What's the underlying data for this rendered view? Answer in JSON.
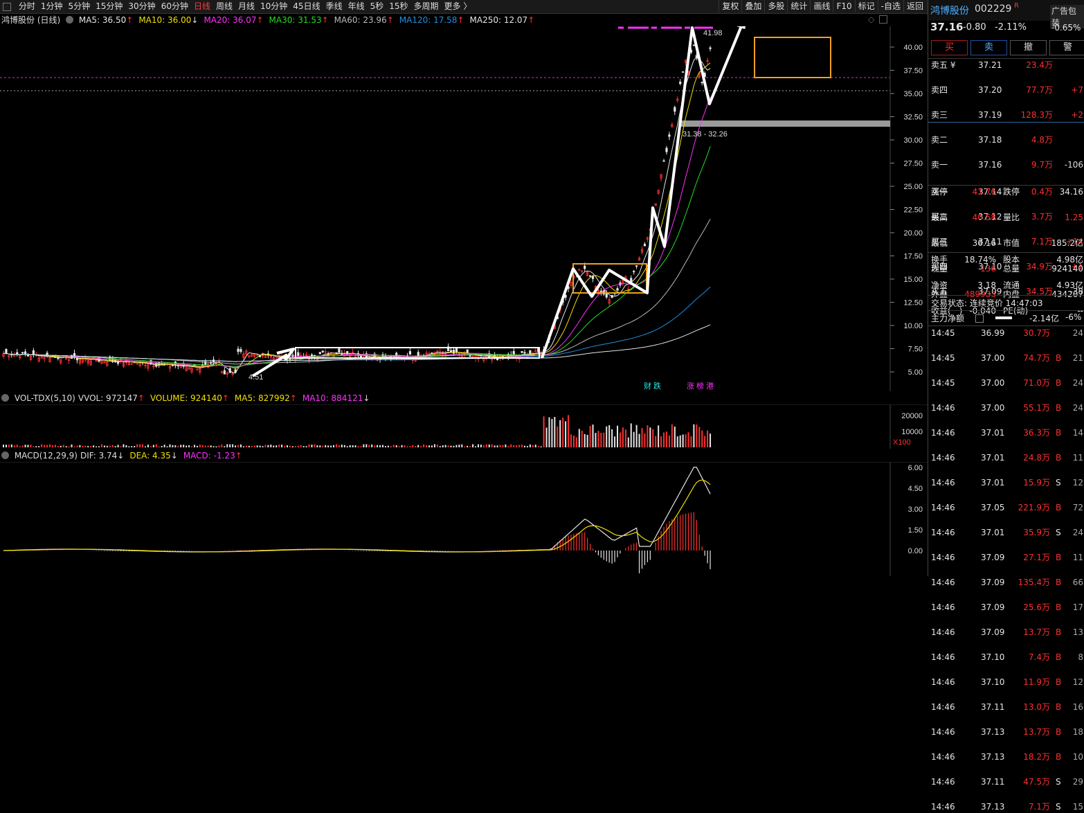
{
  "period_bar": {
    "items": [
      "分时",
      "1分钟",
      "5分钟",
      "15分钟",
      "30分钟",
      "60分钟",
      "日线",
      "周线",
      "月线",
      "10分钟",
      "45日线",
      "季线",
      "年线",
      "5秒",
      "15秒",
      "多周期",
      "更多 〉"
    ],
    "active_index": 6,
    "right_buttons": [
      "复权",
      "叠加",
      "多股",
      "统计",
      "画线",
      "F10",
      "标记",
      "-自选",
      "返回"
    ]
  },
  "ma_line": {
    "stock": "鸿博股份 (日线)",
    "items": [
      {
        "label": "MA5: 36.50",
        "arrow": "↑",
        "color": "#e6e6e6"
      },
      {
        "label": "MA10: 36.00",
        "arrow": "↓",
        "color": "#f0e000"
      },
      {
        "label": "MA20: 36.07",
        "arrow": "↑",
        "color": "#ff30ff"
      },
      {
        "label": "MA30: 31.53",
        "arrow": "↑",
        "color": "#20e020"
      },
      {
        "label": "MA60: 23.96",
        "arrow": "↑",
        "color": "#bbbbbb"
      },
      {
        "label": "MA120: 17.58",
        "arrow": "↑",
        "color": "#2090e0"
      },
      {
        "label": "MA250: 12.07",
        "arrow": "↑",
        "color": "#e6e6e6"
      }
    ]
  },
  "price_axis": [
    "40.00",
    "37.50",
    "35.00",
    "32.50",
    "30.00",
    "27.50",
    "25.00",
    "22.50",
    "20.00",
    "17.50",
    "15.00",
    "12.50",
    "10.00",
    "7.50",
    "5.00"
  ],
  "annotations": {
    "high": "41.98",
    "low": "4.51",
    "gap": "31.38 - 32.26",
    "tag1": "财 跌",
    "tag2": "涨 榜 港"
  },
  "vol_line": {
    "items": [
      {
        "label": "VOL-TDX(5,10)",
        "color": "#dddddd"
      },
      {
        "label": "VVOL: 972147",
        "arrow": "↑",
        "color": "#dddddd"
      },
      {
        "label": "VOLUME: 924140",
        "arrow": "↑",
        "color": "#f0e000"
      },
      {
        "label": "MA5: 827992",
        "arrow": "↑",
        "color": "#f0e000"
      },
      {
        "label": "MA10: 884121",
        "arrow": "↓",
        "color": "#ff30ff"
      }
    ],
    "axis": [
      "20000",
      "10000"
    ],
    "unit": "X100"
  },
  "macd_line": {
    "items": [
      {
        "label": "MACD(12,29,9)",
        "color": "#dddddd"
      },
      {
        "label": "DIF: 3.74",
        "arrow": "↓",
        "color": "#dddddd"
      },
      {
        "label": "DEA: 4.35",
        "arrow": "↓",
        "color": "#f0e000"
      },
      {
        "label": "MACD: -1.23",
        "arrow": "↑",
        "color": "#ff30ff"
      }
    ],
    "axis": [
      "6.00",
      "4.50",
      "3.00",
      "1.50",
      "0.00"
    ]
  },
  "quote": {
    "name": "鸿博股份",
    "code": "002229",
    "badge": "R",
    "ad": "广告包装",
    "price": "37.16",
    "change": "-0.80",
    "pct": "-2.11%",
    "side_pct": "-0.65%",
    "trade_buttons": [
      "买",
      "卖",
      "撤",
      "警"
    ]
  },
  "order_book": {
    "asks": [
      {
        "label": "卖五 ¥",
        "price": "37.21",
        "vol": "23.4万",
        "delta": ""
      },
      {
        "label": "卖四",
        "price": "37.20",
        "vol": "77.7万",
        "delta": "+7"
      },
      {
        "label": "卖三",
        "price": "37.19",
        "vol": "128.3万",
        "delta": "+2"
      },
      {
        "label": "卖二",
        "price": "37.18",
        "vol": "4.8万",
        "delta": ""
      },
      {
        "label": "卖一",
        "price": "37.16",
        "vol": "9.7万",
        "delta": "-106"
      }
    ],
    "bids": [
      {
        "label": "买一",
        "price": "37.14",
        "vol": "0.4万",
        "delta": ""
      },
      {
        "label": "买二",
        "price": "37.12",
        "vol": "3.7万",
        "delta": ""
      },
      {
        "label": "买三",
        "price": "37.11",
        "vol": "7.1万",
        "delta": "+14"
      },
      {
        "label": "买四",
        "price": "37.10",
        "vol": "34.9万",
        "delta": "+1"
      },
      {
        "label": "买五",
        "price": "37.09",
        "vol": "34.5万",
        "delta": "-38"
      }
    ]
  },
  "stats": [
    {
      "l1": "涨停",
      "v1": "41.76",
      "c1": "red",
      "l2": "跌停",
      "v2": "34.16",
      "c2": "wht"
    },
    {
      "l1": "最高",
      "v1": "40.58",
      "c1": "red",
      "l2": "量比",
      "v2": "1.25",
      "c2": "red"
    },
    {
      "l1": "最低",
      "v1": "36.16",
      "c1": "wht",
      "l2": "市值",
      "v2": "185.2亿",
      "c2": "wht"
    },
    {
      "l1": "现量",
      "v1": "136",
      "c1": "red",
      "l2": "总量",
      "v2": "924140",
      "c2": "wht"
    },
    {
      "l1": "外盘",
      "v1": "489933",
      "c1": "red",
      "l2": "内盘",
      "v2": "434207",
      "c2": "wht"
    }
  ],
  "stats2": [
    {
      "l1": "换手",
      "v1": "18.74%",
      "c1": "wht",
      "l2": "股本",
      "v2": "4.98亿",
      "c2": "wht"
    },
    {
      "l1": "净资",
      "v1": "3.18",
      "c1": "wht",
      "l2": "流通",
      "v2": "4.93亿",
      "c2": "wht"
    },
    {
      "l1": "收益(一)",
      "v1": "-0.040",
      "c1": "wht",
      "l2": "PE(动)",
      "v2": "--",
      "c2": "wht"
    }
  ],
  "trade_status": "交易状态: 连续竞价 14:47:03",
  "main_flow": {
    "label": "主力净额",
    "value": "-2.14亿",
    "pct": "-6%"
  },
  "ticks": [
    {
      "t": "14:45",
      "p": "36.99",
      "v": "30.7万",
      "s": "",
      "n": "24"
    },
    {
      "t": "14:45",
      "p": "37.00",
      "v": "74.7万",
      "s": "B",
      "n": "21"
    },
    {
      "t": "14:45",
      "p": "37.00",
      "v": "71.0万",
      "s": "B",
      "n": "24"
    },
    {
      "t": "14:46",
      "p": "37.00",
      "v": "55.1万",
      "s": "B",
      "n": "24"
    },
    {
      "t": "14:46",
      "p": "37.01",
      "v": "36.3万",
      "s": "B",
      "n": "14"
    },
    {
      "t": "14:46",
      "p": "37.01",
      "v": "24.8万",
      "s": "B",
      "n": "11"
    },
    {
      "t": "14:46",
      "p": "37.01",
      "v": "15.9万",
      "s": "S",
      "n": "12"
    },
    {
      "t": "14:46",
      "p": "37.05",
      "v": "221.9万",
      "s": "B",
      "n": "72"
    },
    {
      "t": "14:46",
      "p": "37.01",
      "v": "35.9万",
      "s": "S",
      "n": "24"
    },
    {
      "t": "14:46",
      "p": "37.09",
      "v": "27.1万",
      "s": "B",
      "n": "11"
    },
    {
      "t": "14:46",
      "p": "37.09",
      "v": "135.4万",
      "s": "B",
      "n": "66"
    },
    {
      "t": "14:46",
      "p": "37.09",
      "v": "25.6万",
      "s": "B",
      "n": "17"
    },
    {
      "t": "14:46",
      "p": "37.09",
      "v": "13.7万",
      "s": "B",
      "n": "13"
    },
    {
      "t": "14:46",
      "p": "37.10",
      "v": "7.4万",
      "s": "B",
      "n": "8"
    },
    {
      "t": "14:46",
      "p": "37.10",
      "v": "11.9万",
      "s": "B",
      "n": "12"
    },
    {
      "t": "14:46",
      "p": "37.11",
      "v": "13.0万",
      "s": "B",
      "n": "16"
    },
    {
      "t": "14:46",
      "p": "37.13",
      "v": "13.7万",
      "s": "B",
      "n": "18"
    },
    {
      "t": "14:46",
      "p": "37.13",
      "v": "18.2万",
      "s": "B",
      "n": "10"
    },
    {
      "t": "14:46",
      "p": "37.11",
      "v": "47.5万",
      "s": "S",
      "n": "29"
    },
    {
      "t": "14:46",
      "p": "37.13",
      "v": "7.1万",
      "s": "S",
      "n": "15"
    }
  ]
}
